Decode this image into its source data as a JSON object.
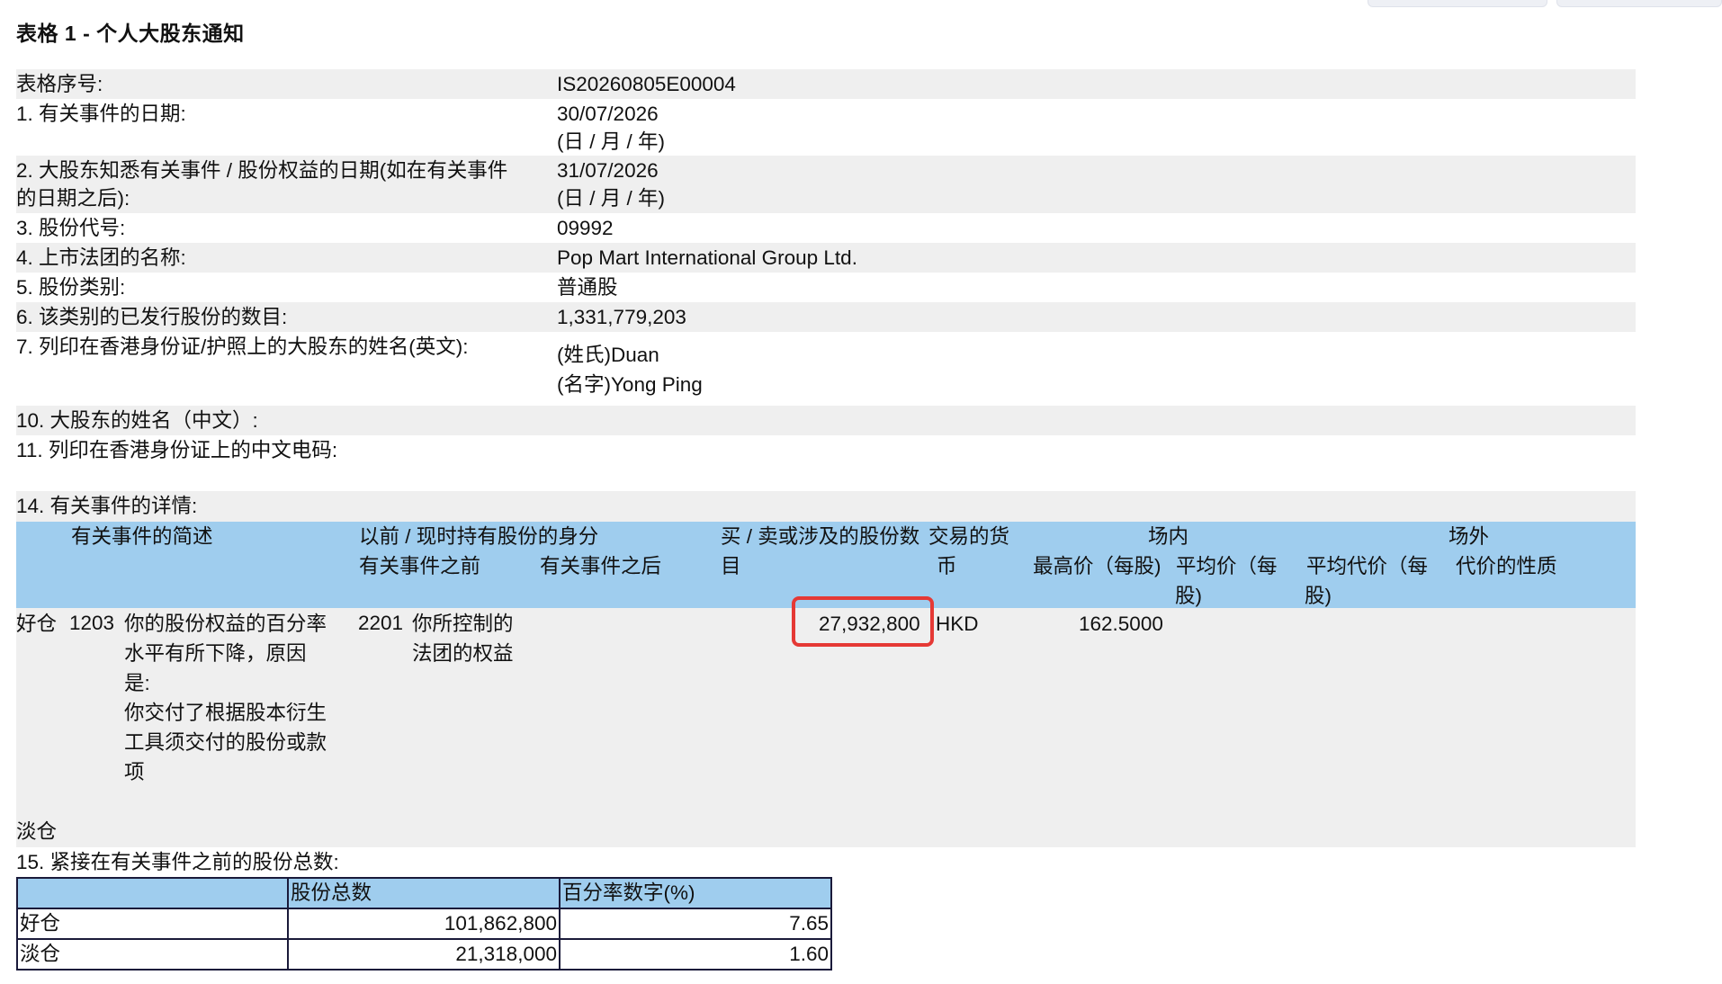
{
  "title": "表格 1 - 个人大股东通知",
  "fields": {
    "form_no": {
      "label": "表格序号:",
      "value": "IS20260805E00004"
    },
    "event_date": {
      "label": "1. 有关事件的日期:",
      "value": "30/07/2026",
      "format": "(日 / 月 / 年)"
    },
    "aware_date": {
      "label_line1": "2. 大股东知悉有关事件 / 股份权益的日期(如在有关事件",
      "label_line2": "的日期之后):",
      "value": "31/07/2026",
      "format": "(日 / 月 / 年)"
    },
    "stock_code": {
      "label": "3. 股份代号:",
      "value": "09992"
    },
    "corp_name": {
      "label": "4. 上市法团的名称:",
      "value": "Pop Mart International Group Ltd."
    },
    "share_class": {
      "label": "5. 股份类别:",
      "value": "普通股"
    },
    "issued_shares": {
      "label": "6. 该类别的已发行股份的数目:",
      "value": "1,331,779,203"
    },
    "name_en": {
      "label": "7. 列印在香港身份证/护照上的大股东的姓名(英文):",
      "surname": "(姓氏)Duan",
      "given": "(名字)Yong Ping"
    },
    "name_cn": {
      "label": "10. 大股东的姓名（中文）:"
    },
    "cn_code": {
      "label": "11. 列印在香港身份证上的中文电码:"
    },
    "details": {
      "label": "14. 有关事件的详情:"
    }
  },
  "details_header": {
    "event_desc": "有关事件的简述",
    "capacity": "以前 / 现时持有股份的身分",
    "before": "有关事件之前",
    "after": "有关事件之后",
    "num_shares_1": "买 / 卖或涉及的股份数",
    "num_shares_2": "目",
    "currency_1": "交易的货",
    "currency_2": "币",
    "onex": "场内",
    "offex": "场外",
    "highest": "最高价（每股)",
    "avg_1": "平均价（每",
    "avg_2": "股)",
    "avg_cons_1": "平均代价（每",
    "avg_cons_2": "股)",
    "nature": "代价的性质"
  },
  "details_row": {
    "position": "好仓",
    "event_code": "1203",
    "event_text": [
      "你的股份权益的百分率",
      "水平有所下降，原因",
      "是:",
      "你交付了根据股本衍生",
      "工具须交付的股份或款",
      "项"
    ],
    "cap_code": "2201",
    "cap_text": [
      "你所控制的",
      "法团的权益"
    ],
    "shares": "27,932,800",
    "currency": "HKD",
    "highest": "162.5000",
    "short": "淡仓"
  },
  "totals": {
    "label": "15. 紧接在有关事件之前的股份总数:",
    "col_shares": "股份总数",
    "col_pct": "百分率数字(%)",
    "rows": [
      {
        "pos": "好仓",
        "shares": "101,862,800",
        "pct": "7.65"
      },
      {
        "pos": "淡仓",
        "shares": "21,318,000",
        "pct": "1.60"
      }
    ]
  }
}
